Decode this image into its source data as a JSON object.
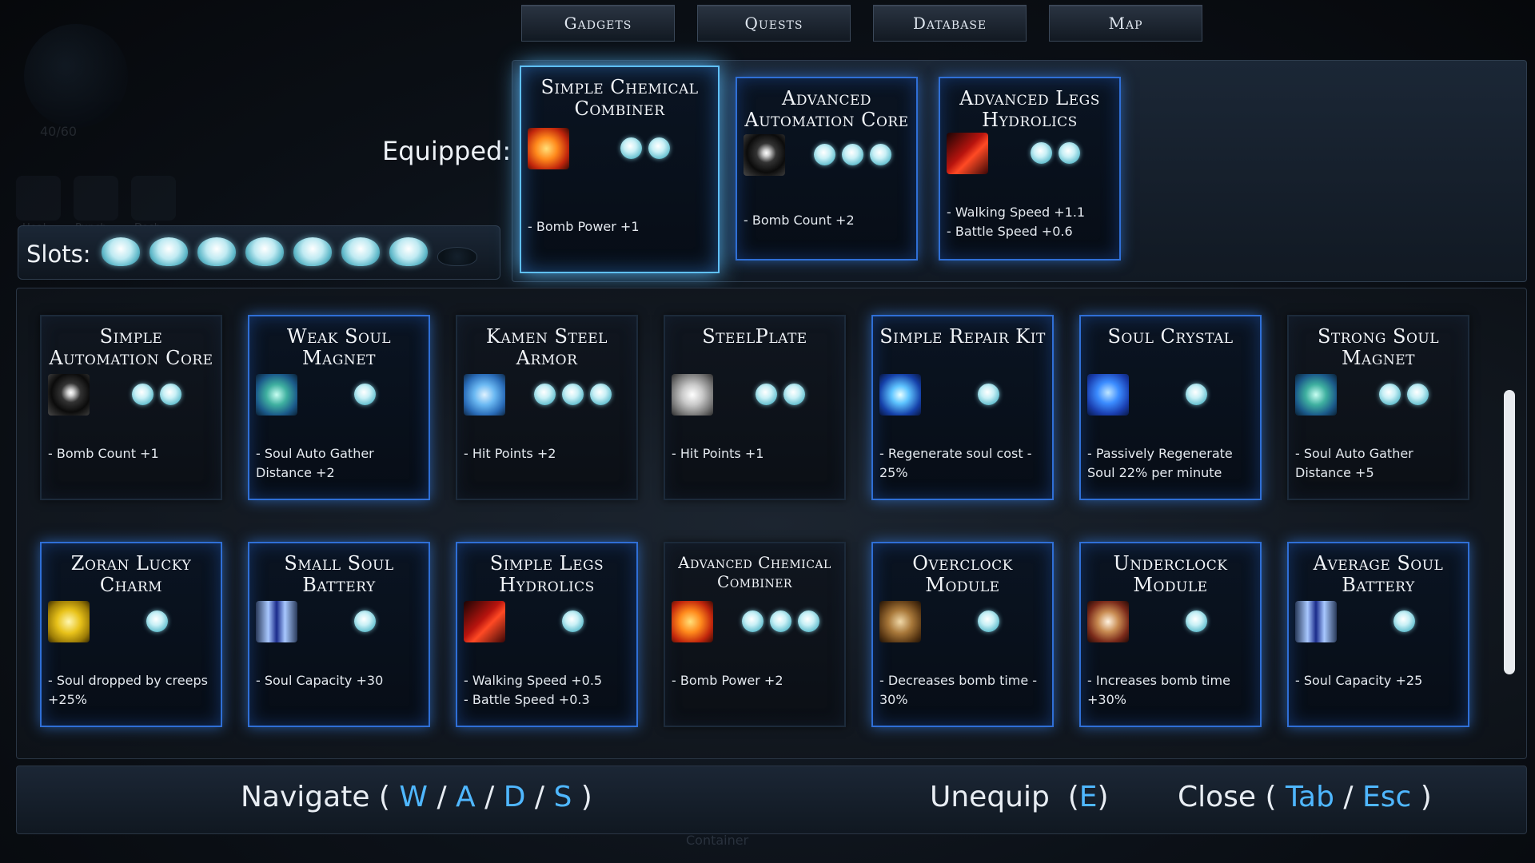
{
  "tabs": [
    {
      "label": "Gadgets"
    },
    {
      "label": "Quests"
    },
    {
      "label": "Database"
    },
    {
      "label": "Map"
    }
  ],
  "background_hud": {
    "counter": "40/60",
    "abilities": [
      "Heal",
      "Punch",
      "Dash"
    ],
    "footer": "Container"
  },
  "equipped": {
    "label": "Equipped:",
    "items": [
      {
        "title": "Simple Chemical Combiner",
        "icon": "fire-icon",
        "slots": 2,
        "desc": [
          "- Bomb Power +1"
        ]
      },
      {
        "title": "Advanced Automation Core",
        "icon": "bomb-icon",
        "slots": 3,
        "desc": [
          "- Bomb Count +2"
        ]
      },
      {
        "title": "Advanced Legs Hydrolics",
        "icon": "legs-icon",
        "slots": 2,
        "desc": [
          "- Walking Speed +1.1",
          "- Battle Speed +0.6"
        ]
      }
    ]
  },
  "slots": {
    "label": "Slots:",
    "filled": 7,
    "total": 8
  },
  "inventory": {
    "rows": [
      [
        {
          "title": "Simple Automation Core",
          "icon": "bomb-icon",
          "slots": 2,
          "desc": [
            "- Bomb Count +1"
          ],
          "dim": true
        },
        {
          "title": "Weak Soul Magnet",
          "icon": "magnet-icon",
          "slots": 1,
          "desc": [
            "- Soul Auto Gather Distance +2"
          ]
        },
        {
          "title": "Kamen Steel Armor",
          "icon": "armor-icon",
          "slots": 3,
          "desc": [
            "- Hit Points +2"
          ],
          "dim": true
        },
        {
          "title": "SteelPlate",
          "icon": "steelplate-icon",
          "slots": 2,
          "desc": [
            "- Hit Points +1"
          ],
          "dim": true
        },
        {
          "title": "Simple Repair Kit",
          "icon": "repair-kit-icon",
          "slots": 1,
          "desc": [
            "- Regenerate soul cost - 25%"
          ]
        },
        {
          "title": "Soul Crystal",
          "icon": "crystal-icon",
          "slots": 1,
          "desc": [
            "- Passively Regenerate Soul 22% per minute"
          ]
        },
        {
          "title": "Strong Soul Magnet",
          "icon": "magnet-icon",
          "slots": 2,
          "desc": [
            "- Soul Auto Gather Distance +5"
          ],
          "dim": true
        }
      ],
      [
        {
          "title": "Zoran Lucky Charm",
          "icon": "charm-icon",
          "slots": 1,
          "desc": [
            "- Soul dropped by creeps +25%"
          ]
        },
        {
          "title": "Small Soul Battery",
          "icon": "battery-icon",
          "slots": 1,
          "desc": [
            "- Soul Capacity +30"
          ]
        },
        {
          "title": "Simple Legs Hydrolics",
          "icon": "legs-icon",
          "slots": 1,
          "desc": [
            "- Walking Speed +0.5",
            "- Battle Speed +0.3"
          ]
        },
        {
          "title": "Advanced Chemical Combiner",
          "icon": "fire-icon",
          "slots": 3,
          "desc": [
            "- Bomb Power +2"
          ],
          "dim": true,
          "smallTitle": true
        },
        {
          "title": "Overclock Module",
          "icon": "gear-icon",
          "slots": 1,
          "desc": [
            "- Decreases bomb time - 30%"
          ]
        },
        {
          "title": "Underclock Module",
          "icon": "clock-icon",
          "slots": 1,
          "desc": [
            "- Increases bomb time +30%"
          ]
        },
        {
          "title": "Average Soul Battery",
          "icon": "battery-icon",
          "slots": 1,
          "desc": [
            "- Soul Capacity +25"
          ]
        }
      ]
    ]
  },
  "controls": {
    "navigate_label": "Navigate",
    "navigate_keys": [
      "W",
      "A",
      "D",
      "S"
    ],
    "unequip_label": "Unequip",
    "unequip_key": "E",
    "close_label": "Close",
    "close_keys": [
      "Tab",
      "Esc"
    ]
  },
  "colors": {
    "accent_key": "#4fb7ff",
    "card_border": "#2f6fd6",
    "slot_gem": "#9fe3ee"
  }
}
